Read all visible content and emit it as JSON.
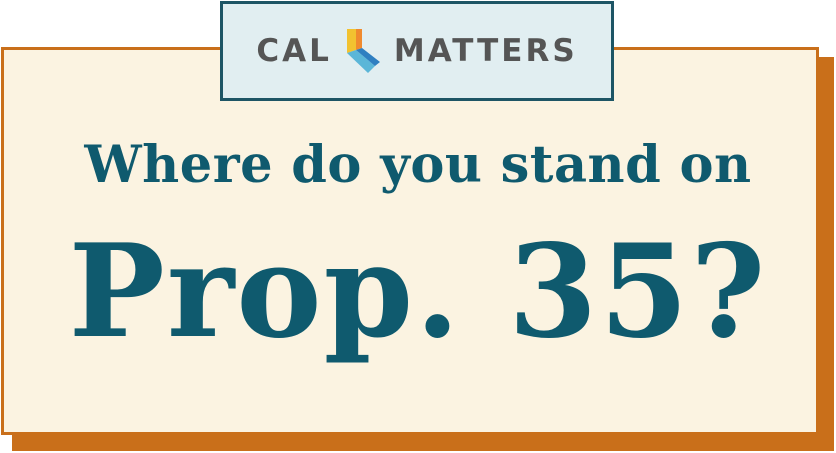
{
  "logo": {
    "left_text": "CAL",
    "right_text": "MATTERS",
    "mark_icon": "california-state-icon",
    "mark_colors": [
      "#f2c230",
      "#f08a2e",
      "#5bb6d8",
      "#2f7fc1"
    ]
  },
  "headline": {
    "line1": "Where do you stand on",
    "line2": "Prop. 35?"
  },
  "colors": {
    "text": "#0f5a6e",
    "background": "#fbf3e1",
    "border": "#c96f1a",
    "logo_bg": "#e1eef1",
    "logo_border": "#1d5565",
    "logo_text": "#555555"
  }
}
